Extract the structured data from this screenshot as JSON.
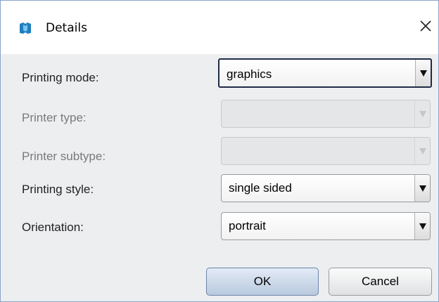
{
  "window": {
    "title": "Details",
    "app_icon": "printer-app-icon",
    "close_icon": "close-icon"
  },
  "form": {
    "printing_mode": {
      "label": "Printing mode:",
      "value": "graphics",
      "enabled": true,
      "focused": true
    },
    "printer_type": {
      "label": "Printer type:",
      "value": "",
      "enabled": false
    },
    "printer_subtype": {
      "label": "Printer subtype:",
      "value": "",
      "enabled": false
    },
    "printing_style": {
      "label": "Printing style:",
      "value": "single sided",
      "enabled": true
    },
    "orientation": {
      "label": "Orientation:",
      "value": "portrait",
      "enabled": true
    }
  },
  "buttons": {
    "ok_label": "OK",
    "cancel_label": "Cancel"
  },
  "colors": {
    "accent": "#1f2a44",
    "client_bg": "#eceef0",
    "app_icon": "#1d7fbf"
  }
}
